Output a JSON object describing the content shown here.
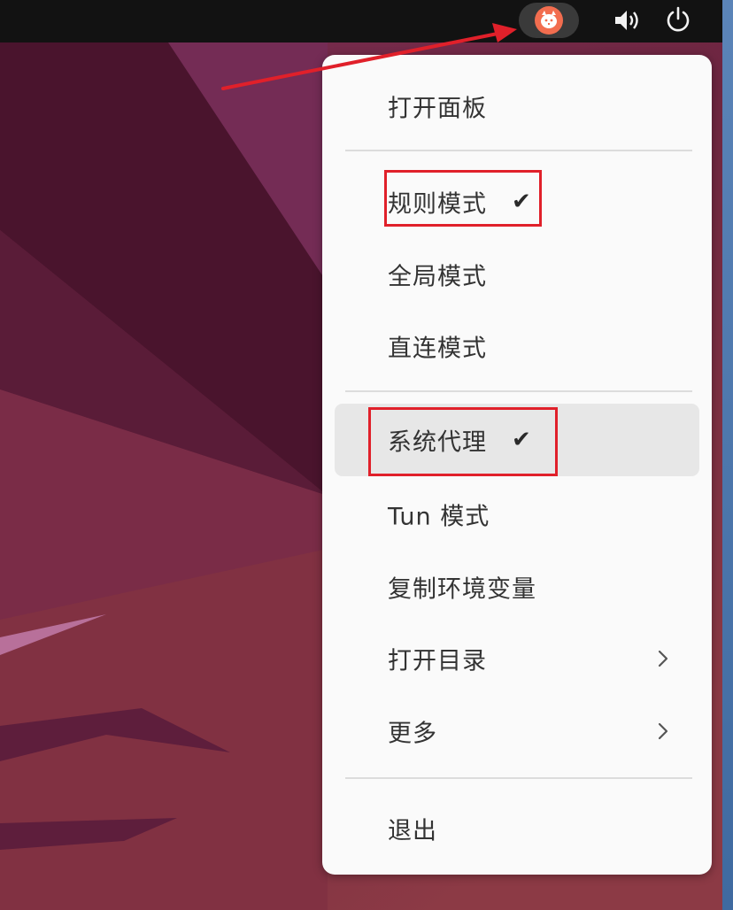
{
  "topbar": {
    "tray": {
      "app_icon": "cat-icon",
      "volume_icon": "volume-icon",
      "power_icon": "power-icon"
    }
  },
  "menu": {
    "open_panel": "打开面板",
    "rule_mode": "规则模式",
    "global_mode": "全局模式",
    "direct_mode": "直连模式",
    "system_proxy": "系统代理",
    "tun_mode": "Tun 模式",
    "copy_env": "复制环境变量",
    "open_directory": "打开目录",
    "more": "更多",
    "quit": "退出",
    "check_mark": "✔"
  },
  "colors": {
    "annotation": "#e0202a",
    "menu_bg": "#fafafa",
    "topbar_bg": "#121212",
    "tray_icon_bg": "#f26d4f"
  }
}
